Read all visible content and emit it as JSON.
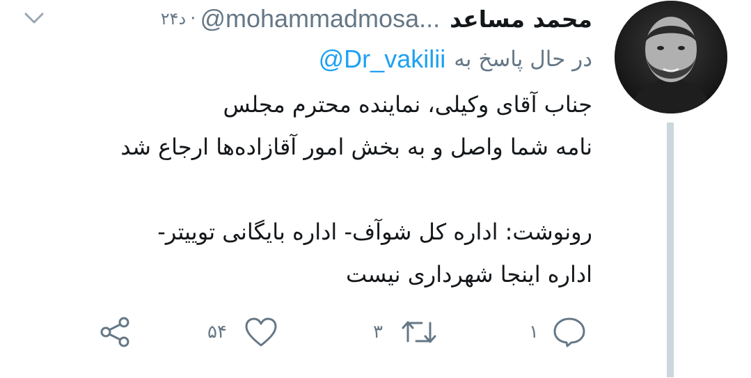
{
  "tweet": {
    "display_name": "محمد مساعد",
    "handle": "@mohammadmosa...",
    "separator": "·",
    "time": "۲۴د",
    "reply_label": "در حال پاسخ به",
    "reply_mention": "@Dr_vakilii",
    "lines": [
      "جناب آقای وکیلی، نماینده محترم مجلس",
      "نامه شما واصل و به بخش امور آقازاده‌ها ارجاع شد",
      "",
      "رونوشت: اداره کل شوآف- اداره بایگانی توییتر-",
      "اداره اینجا شهرداری نیست"
    ],
    "actions": {
      "reply_count": "۱",
      "retweet_count": "۳",
      "like_count": "۵۴"
    }
  },
  "icons": {
    "menu": "chevron-down-icon",
    "reply": "speech-bubble-icon",
    "retweet": "retweet-arrows-icon",
    "like": "heart-icon",
    "share": "share-nodes-icon"
  },
  "colors": {
    "text": "#14171a",
    "secondary": "#657786",
    "link": "#1da1f2",
    "thread_line": "#ccd6dd"
  }
}
